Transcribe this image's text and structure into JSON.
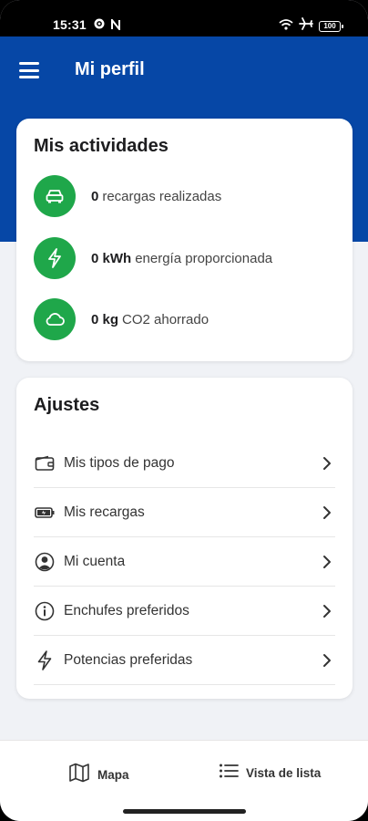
{
  "status_bar": {
    "time": "15:31",
    "left_icons": [
      "settings-icon",
      "n-badge-icon"
    ],
    "right_icons": [
      "wifi-icon",
      "airplane-icon",
      "battery-icon"
    ],
    "battery_level": "100"
  },
  "header": {
    "title": "Mi perfil",
    "background_color": "#0647a6"
  },
  "activities": {
    "title": "Mis actividades",
    "accent_color": "#1fa74a",
    "items": [
      {
        "icon": "car-icon",
        "value": "0",
        "text": "recargas realizadas"
      },
      {
        "icon": "bolt-icon",
        "value": "0 kWh",
        "text": "energía proporcionada"
      },
      {
        "icon": "cloud-icon",
        "value": "0 kg",
        "text": "CO2 ahorrado"
      }
    ]
  },
  "settings": {
    "title": "Ajustes",
    "items": [
      {
        "icon": "wallet-icon",
        "label": "Mis tipos de pago"
      },
      {
        "icon": "battery-charge-icon",
        "label": "Mis recargas"
      },
      {
        "icon": "account-icon",
        "label": "Mi cuenta"
      },
      {
        "icon": "info-icon",
        "label": "Enchufes preferidos"
      },
      {
        "icon": "bolt-outline-icon",
        "label": "Potencias preferidas"
      }
    ]
  },
  "bottom_nav": {
    "map": {
      "icon": "map-icon",
      "label": "Mapa"
    },
    "list": {
      "icon": "list-icon",
      "label": "Vista de lista"
    }
  }
}
